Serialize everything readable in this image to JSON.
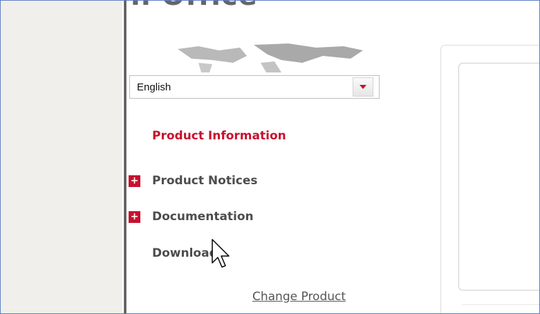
{
  "header": {
    "title_fragment": "n Office"
  },
  "language_select": {
    "value": "English"
  },
  "nav": {
    "items": [
      {
        "label": "Product Information",
        "active": true,
        "expandable": false
      },
      {
        "label": "Product Notices",
        "active": false,
        "expandable": true
      },
      {
        "label": "Documentation",
        "active": false,
        "expandable": true
      },
      {
        "label": "Downloads",
        "active": false,
        "expandable": false
      }
    ],
    "expand_glyph": "+"
  },
  "change_product": {
    "label": "Change Product"
  },
  "colors": {
    "accent_red": "#c8102e",
    "nav_gray": "#4d4d4d",
    "frame_blue": "#5b7fc4",
    "gutter": "#f0efeb"
  },
  "icons": {
    "select_arrow": "chevron-down-icon",
    "expand": "plus-icon",
    "cursor": "mouse-pointer-icon",
    "map": "world-map-icon"
  }
}
